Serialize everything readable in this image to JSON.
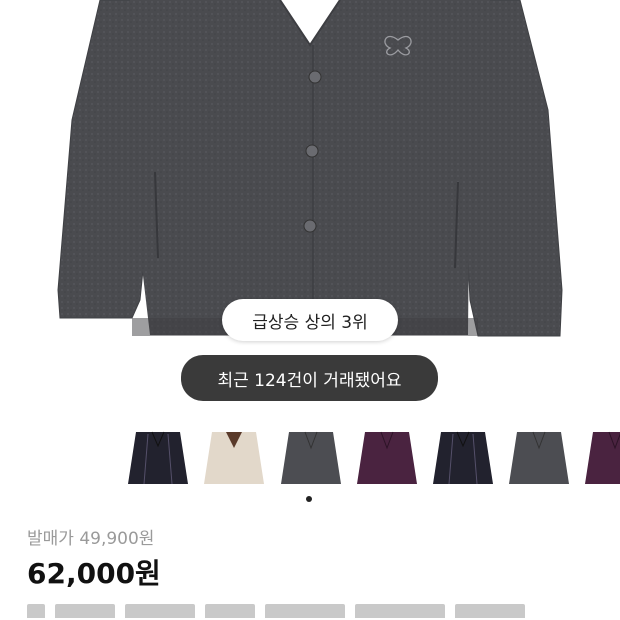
{
  "badges": {
    "trend": "급상승 상의 3위",
    "recent_trades": "최근 124건이 거래됐어요"
  },
  "colors": {
    "main_cardigan": "#4a4b4f",
    "pill_dark_bg": "#3a3a3a",
    "price_label": "#9a9a9a"
  },
  "thumbnails": [
    {
      "color_name": "black-stripe",
      "color": "#22222e"
    },
    {
      "color_name": "ivory",
      "color": "#e2d8ca"
    },
    {
      "color_name": "charcoal",
      "color": "#4c4d52"
    },
    {
      "color_name": "purple",
      "color": "#4a2340"
    },
    {
      "color_name": "black-stripe",
      "color": "#22222e"
    },
    {
      "color_name": "charcoal",
      "color": "#4c4d52"
    },
    {
      "color_name": "purple",
      "color": "#4a2340"
    }
  ],
  "pager": {
    "active_index": 1
  },
  "pricing": {
    "release_price": "발매가 49,900원",
    "current_price": "62,000원"
  }
}
